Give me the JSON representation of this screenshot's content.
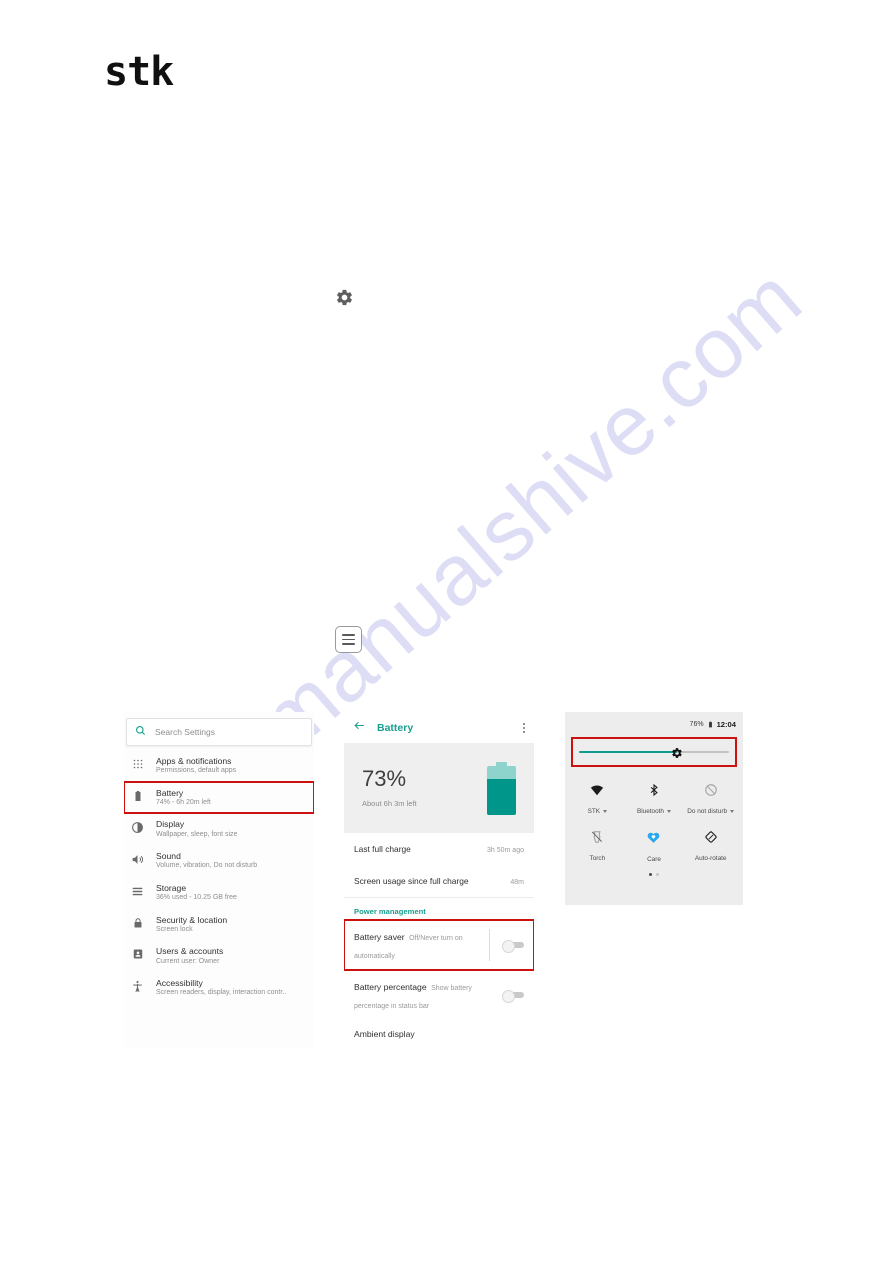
{
  "brand": {
    "logo_text": "stk"
  },
  "watermark": {
    "text": "manualshive.com"
  },
  "standalone_icons": {
    "gear": "gear-icon",
    "hamburger": "hamburger-menu-icon"
  },
  "colors": {
    "accent_teal": "#1a9e8f",
    "battery_fill": "#00968a",
    "battery_empty": "#8fd4cc",
    "highlight_red": "#cc1111",
    "quick_settings_bg": "#ededed",
    "care_blue": "#29a8f0"
  },
  "settings_panel": {
    "search": {
      "placeholder": "Search Settings",
      "icon": "search-icon"
    },
    "items": [
      {
        "icon": "apps-grid-icon",
        "title": "Apps & notifications",
        "subtitle": "Permissions, default apps",
        "highlighted": false
      },
      {
        "icon": "battery-icon",
        "title": "Battery",
        "subtitle": "74% - 6h 20m left",
        "highlighted": true
      },
      {
        "icon": "display-icon",
        "title": "Display",
        "subtitle": "Wallpaper, sleep, font size",
        "highlighted": false
      },
      {
        "icon": "sound-icon",
        "title": "Sound",
        "subtitle": "Volume, vibration, Do not disturb",
        "highlighted": false
      },
      {
        "icon": "storage-icon",
        "title": "Storage",
        "subtitle": "36% used - 10.25 GB free",
        "highlighted": false
      },
      {
        "icon": "lock-icon",
        "title": "Security & location",
        "subtitle": "Screen lock",
        "highlighted": false
      },
      {
        "icon": "person-icon",
        "title": "Users & accounts",
        "subtitle": "Current user: Owner",
        "highlighted": false
      },
      {
        "icon": "accessibility-icon",
        "title": "Accessibility",
        "subtitle": "Screen readers, display, interaction contr..",
        "highlighted": false
      }
    ]
  },
  "battery_panel": {
    "appbar": {
      "back_icon": "back-arrow-icon",
      "title": "Battery",
      "overflow_icon": "overflow-menu-icon"
    },
    "hero": {
      "percent": "73%",
      "time_left": "About 6h 3m left",
      "fill_level": 73
    },
    "info_rows": [
      {
        "label": "Last full charge",
        "value": "3h 50m ago"
      },
      {
        "label": "Screen usage since full charge",
        "value": "48m"
      }
    ],
    "section_header": "Power management",
    "toggles": [
      {
        "title": "Battery saver",
        "subtitle": "Off/Never turn on automatically",
        "on": false,
        "highlighted": true
      },
      {
        "title": "Battery percentage",
        "subtitle": "Show battery percentage in status bar",
        "on": false,
        "highlighted": false
      }
    ],
    "last_item": "Ambient display"
  },
  "quick_settings": {
    "status_bar": {
      "battery_percent": "76%",
      "battery_icon": "battery-icon",
      "time": "12:04"
    },
    "brightness": {
      "level": 65,
      "thumb_icon": "brightness-icon",
      "highlighted": true
    },
    "tiles": [
      {
        "icon": "wifi-icon",
        "label": "STK",
        "has_caret": true,
        "active": false
      },
      {
        "icon": "bluetooth-icon",
        "label": "Bluetooth",
        "has_caret": true,
        "active": false
      },
      {
        "icon": "do-not-disturb-icon",
        "label": "Do not disturb",
        "has_caret": true,
        "active": false
      },
      {
        "icon": "torch-icon",
        "label": "Torch",
        "has_caret": false,
        "active": false
      },
      {
        "icon": "care-heart-icon",
        "label": "Care",
        "has_caret": false,
        "active": true
      },
      {
        "icon": "auto-rotate-icon",
        "label": "Auto-rotate",
        "has_caret": false,
        "active": false
      }
    ],
    "pages": {
      "count": 2,
      "current": 1
    }
  }
}
